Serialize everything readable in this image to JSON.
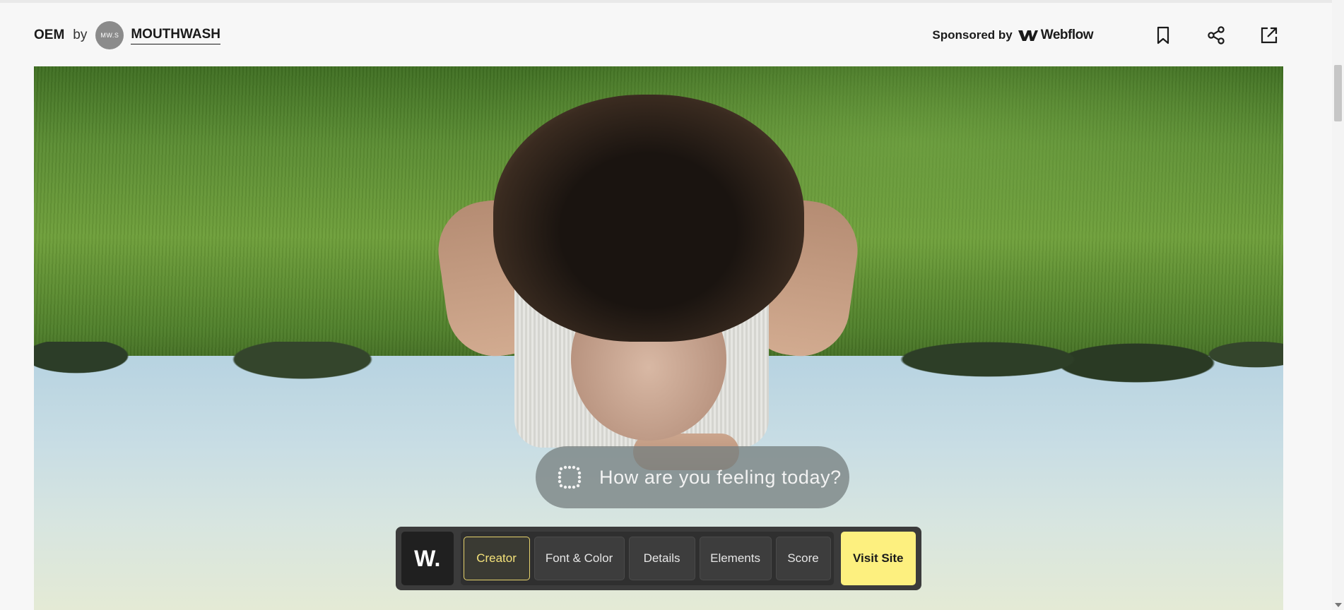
{
  "header": {
    "site_name": "OEM",
    "by": "by",
    "avatar_text": "MW.S",
    "creator": "MOUTHWASH",
    "sponsored_label": "Sponsored by",
    "sponsor_name": "Webflow",
    "icons": [
      "bookmark-icon",
      "share-icon",
      "external-link-icon"
    ]
  },
  "hero": {
    "prompt_text": "How are you feeling today?"
  },
  "toolbar": {
    "logo": "W.",
    "tabs": [
      {
        "label": "Creator",
        "active": true
      },
      {
        "label": "Font & Color",
        "active": false
      },
      {
        "label": "Details",
        "active": false
      },
      {
        "label": "Elements",
        "active": false
      },
      {
        "label": "Score",
        "active": false
      }
    ],
    "visit_label": "Visit Site"
  },
  "colors": {
    "accent_yellow": "#fdf07f",
    "active_tab_text": "#f4e27a",
    "toolbar_bg": "#3b3b3b"
  }
}
